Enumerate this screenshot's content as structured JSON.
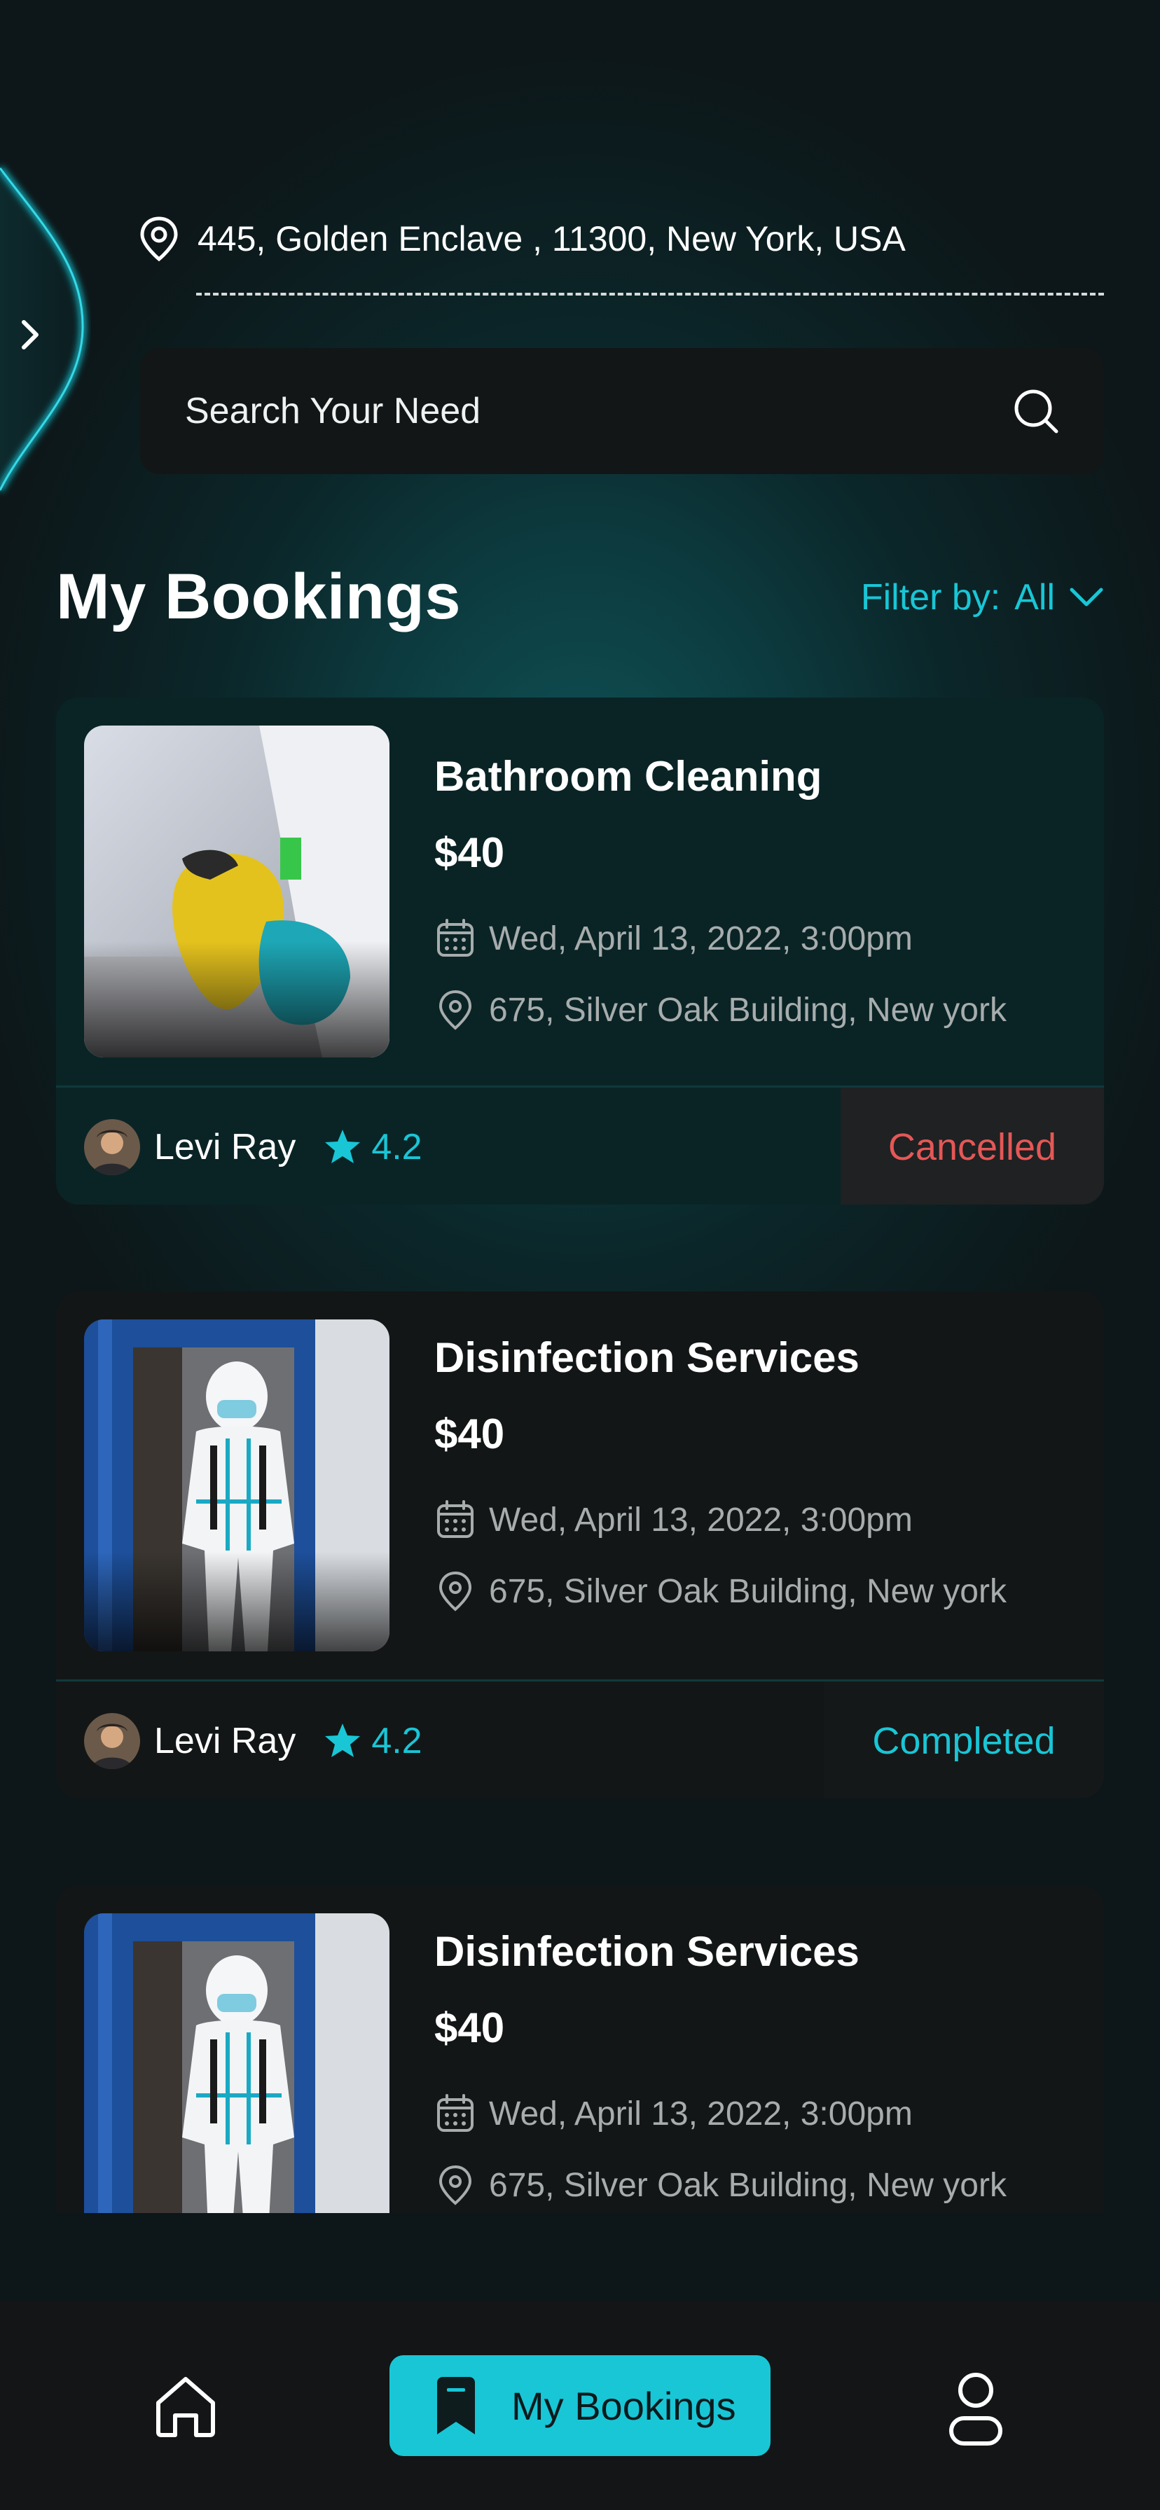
{
  "header": {
    "address": "445,  Golden Enclave , 11300, New York, USA",
    "search_placeholder": "Search Your Need"
  },
  "section": {
    "title": "My Bookings",
    "filter_label": "Filter by:",
    "filter_value": "All"
  },
  "bookings": [
    {
      "service": "Bathroom Cleaning",
      "price": "$40",
      "date": "Wed, April 13, 2022, 3:00pm",
      "location": "675, Silver Oak Building, New york",
      "provider": "Levi Ray",
      "rating": "4.2",
      "status": "Cancelled"
    },
    {
      "service": "Disinfection Services",
      "price": "$40",
      "date": "Wed, April 13, 2022, 3:00pm",
      "location": "675, Silver Oak Building, New york",
      "provider": "Levi Ray",
      "rating": "4.2",
      "status": "Completed"
    },
    {
      "service": "Disinfection Services",
      "price": "$40",
      "date": "Wed, April 13, 2022, 3:00pm",
      "location": "675, Silver Oak Building, New york"
    }
  ],
  "nav": {
    "active_label": "My Bookings",
    "icons": [
      "home-icon",
      "bookmark-icon",
      "profile-icon"
    ]
  },
  "colors": {
    "accent": "#19c6d6",
    "cancelled": "#e55757",
    "background": "#0d1618"
  }
}
